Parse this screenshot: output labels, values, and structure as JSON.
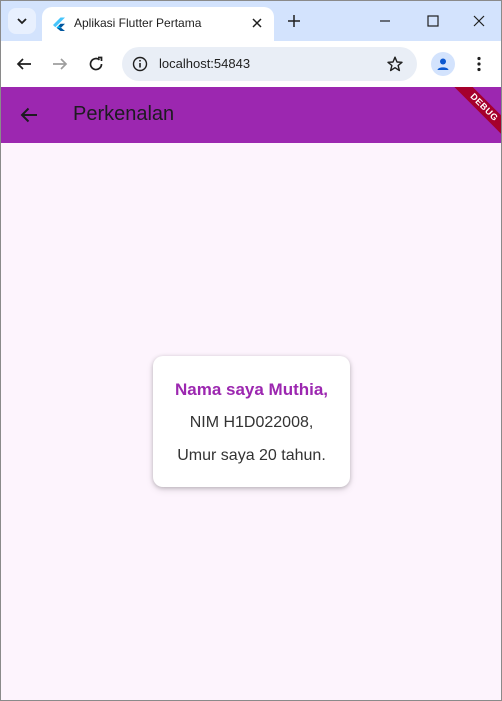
{
  "browser": {
    "tab": {
      "title": "Aplikasi Flutter Pertama",
      "favicon": "flutter-icon"
    },
    "address": {
      "url": "localhost:54843"
    },
    "icons": [
      "tab-search-icon",
      "close-icon",
      "plus-icon",
      "minimize-icon",
      "maximize-icon",
      "window-close-icon",
      "back-icon",
      "forward-icon",
      "reload-icon",
      "info-icon",
      "star-icon",
      "profile-icon",
      "kebab-menu-icon"
    ]
  },
  "app": {
    "appbar": {
      "title": "Perkenalan",
      "color": "#9c27b0"
    },
    "debug_banner": "DEBUG",
    "card": {
      "name": "Nama saya Muthia,",
      "nim": "NIM H1D022008,",
      "age": "Umur saya 20 tahun."
    },
    "background": "#fdf4fd"
  }
}
